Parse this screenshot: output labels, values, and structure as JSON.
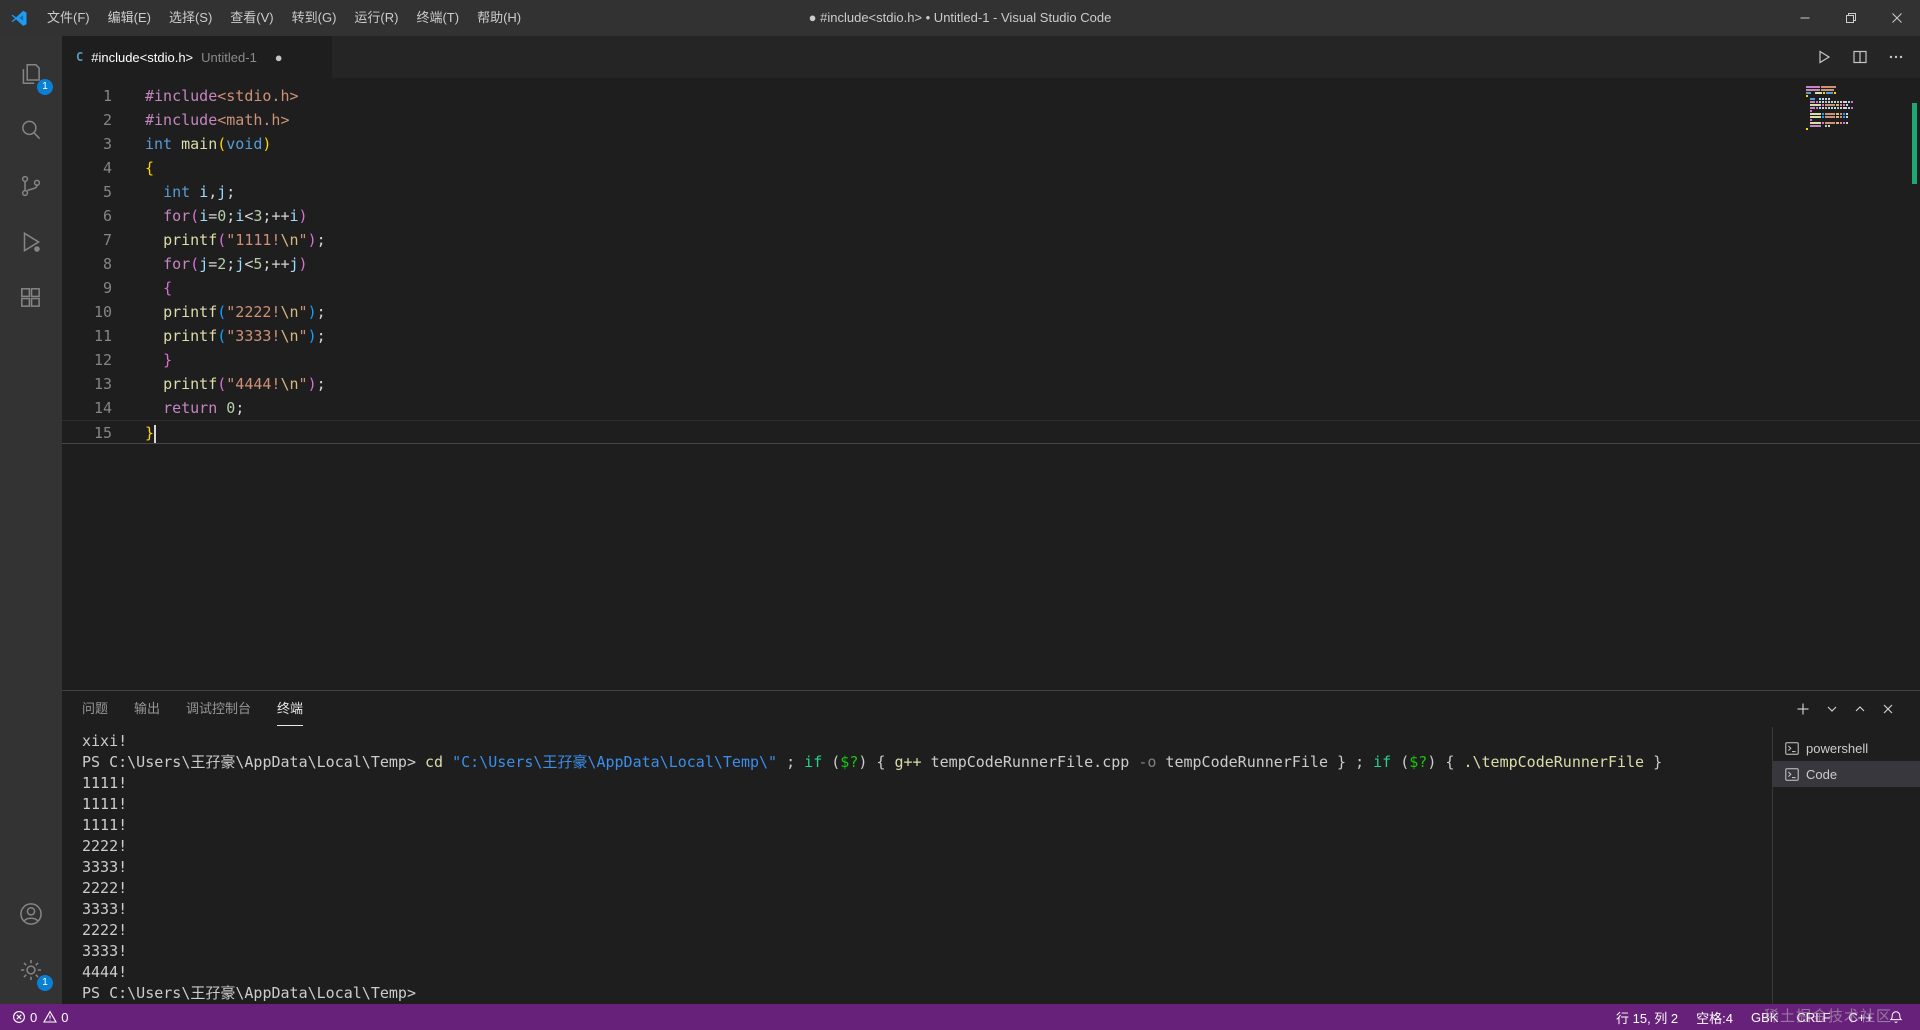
{
  "window": {
    "title": "● #include<stdio.h> • Untitled-1 - Visual Studio Code"
  },
  "menus": [
    "文件(F)",
    "编辑(E)",
    "选择(S)",
    "查看(V)",
    "转到(G)",
    "运行(R)",
    "终端(T)",
    "帮助(H)"
  ],
  "activity_bar": {
    "explorer_badge": "1",
    "settings_badge": "1"
  },
  "tab": {
    "file_icon": "C",
    "title": "#include<stdio.h>",
    "secondary": "Untitled-1",
    "dirty": "●"
  },
  "editor": {
    "cursor_line": 15,
    "lines": [
      [
        [
          "#include",
          "pp"
        ],
        [
          "<stdio.h>",
          "str"
        ]
      ],
      [
        [
          "#include",
          "pp"
        ],
        [
          "<math.h>",
          "str"
        ]
      ],
      [
        [
          "int",
          "kw"
        ],
        [
          " ",
          "pl"
        ],
        [
          "main",
          "fn"
        ],
        [
          "(",
          "b1"
        ],
        [
          "void",
          "kw"
        ],
        [
          ")",
          "b1"
        ]
      ],
      [
        [
          "{",
          "b1"
        ]
      ],
      [
        [
          "  ",
          "pl"
        ],
        [
          "int",
          "kw"
        ],
        [
          " ",
          "pl"
        ],
        [
          "i",
          "var"
        ],
        [
          ",",
          "pl"
        ],
        [
          "j",
          "var"
        ],
        [
          ";",
          "pl"
        ]
      ],
      [
        [
          "  ",
          "pl"
        ],
        [
          "for",
          "pp"
        ],
        [
          "(",
          "b2"
        ],
        [
          "i",
          "var"
        ],
        [
          "=",
          "pl"
        ],
        [
          "0",
          "num"
        ],
        [
          ";",
          "pl"
        ],
        [
          "i",
          "var"
        ],
        [
          "<",
          "pl"
        ],
        [
          "3",
          "num"
        ],
        [
          ";",
          "pl"
        ],
        [
          "++",
          "pl"
        ],
        [
          "i",
          "var"
        ],
        [
          ")",
          "b2"
        ]
      ],
      [
        [
          "  ",
          "pl"
        ],
        [
          "printf",
          "fn"
        ],
        [
          "(",
          "b2"
        ],
        [
          "\"1111!",
          "str"
        ],
        [
          "\\n",
          "esc"
        ],
        [
          "\"",
          "str"
        ],
        [
          ")",
          "b2"
        ],
        [
          ";",
          "pl"
        ]
      ],
      [
        [
          "  ",
          "pl"
        ],
        [
          "for",
          "pp"
        ],
        [
          "(",
          "b2"
        ],
        [
          "j",
          "var"
        ],
        [
          "=",
          "pl"
        ],
        [
          "2",
          "num"
        ],
        [
          ";",
          "pl"
        ],
        [
          "j",
          "var"
        ],
        [
          "<",
          "pl"
        ],
        [
          "5",
          "num"
        ],
        [
          ";",
          "pl"
        ],
        [
          "++",
          "pl"
        ],
        [
          "j",
          "var"
        ],
        [
          ")",
          "b2"
        ]
      ],
      [
        [
          "  ",
          "pl"
        ],
        [
          "{",
          "b2"
        ]
      ],
      [
        [
          "  ",
          "pl"
        ],
        [
          "printf",
          "fn"
        ],
        [
          "(",
          "b3"
        ],
        [
          "\"2222!",
          "str"
        ],
        [
          "\\n",
          "esc"
        ],
        [
          "\"",
          "str"
        ],
        [
          ")",
          "b3"
        ],
        [
          ";",
          "pl"
        ]
      ],
      [
        [
          "  ",
          "pl"
        ],
        [
          "printf",
          "fn"
        ],
        [
          "(",
          "b3"
        ],
        [
          "\"3333!",
          "str"
        ],
        [
          "\\n",
          "esc"
        ],
        [
          "\"",
          "str"
        ],
        [
          ")",
          "b3"
        ],
        [
          ";",
          "pl"
        ]
      ],
      [
        [
          "  ",
          "pl"
        ],
        [
          "}",
          "b2"
        ]
      ],
      [
        [
          "  ",
          "pl"
        ],
        [
          "printf",
          "fn"
        ],
        [
          "(",
          "b2"
        ],
        [
          "\"4444!",
          "str"
        ],
        [
          "\\n",
          "esc"
        ],
        [
          "\"",
          "str"
        ],
        [
          ")",
          "b2"
        ],
        [
          ";",
          "pl"
        ]
      ],
      [
        [
          "  ",
          "pl"
        ],
        [
          "return",
          "pp"
        ],
        [
          " ",
          "pl"
        ],
        [
          "0",
          "num"
        ],
        [
          ";",
          "pl"
        ]
      ],
      [
        [
          "}",
          "b1"
        ]
      ]
    ]
  },
  "panel": {
    "tabs": [
      {
        "label": "问题",
        "active": false
      },
      {
        "label": "输出",
        "active": false
      },
      {
        "label": "调试控制台",
        "active": false
      },
      {
        "label": "终端",
        "active": true
      }
    ],
    "terminal": {
      "lines": [
        [
          [
            "xixi!",
            "def"
          ]
        ],
        [
          [
            "PS C:\\Users\\王孖豪\\AppData\\Local\\Temp> ",
            "def"
          ],
          [
            "cd",
            "cmd"
          ],
          [
            " ",
            "def"
          ],
          [
            "\"C:\\Users\\王孖豪\\AppData\\Local\\Temp\\\"",
            "str"
          ],
          [
            " ; ",
            "def"
          ],
          [
            "if",
            "kw"
          ],
          [
            " (",
            "def"
          ],
          [
            "$?",
            "var"
          ],
          [
            ") { ",
            "def"
          ],
          [
            "g++",
            "cmd"
          ],
          [
            " tempCodeRunnerFile.cpp ",
            "def"
          ],
          [
            "-o",
            "param"
          ],
          [
            " tempCodeRunnerFile } ; ",
            "def"
          ],
          [
            "if",
            "kw"
          ],
          [
            " (",
            "def"
          ],
          [
            "$?",
            "var"
          ],
          [
            ") { ",
            "def"
          ],
          [
            ".\\tempCodeRunnerFile",
            "cmd"
          ],
          [
            " }",
            "def"
          ]
        ],
        [
          [
            "1111!",
            "def"
          ]
        ],
        [
          [
            "1111!",
            "def"
          ]
        ],
        [
          [
            "1111!",
            "def"
          ]
        ],
        [
          [
            "2222!",
            "def"
          ]
        ],
        [
          [
            "3333!",
            "def"
          ]
        ],
        [
          [
            "2222!",
            "def"
          ]
        ],
        [
          [
            "3333!",
            "def"
          ]
        ],
        [
          [
            "2222!",
            "def"
          ]
        ],
        [
          [
            "3333!",
            "def"
          ]
        ],
        [
          [
            "4444!",
            "def"
          ]
        ],
        [
          [
            "PS C:\\Users\\王孖豪\\AppData\\Local\\Temp>",
            "def"
          ]
        ]
      ],
      "sidebar": [
        {
          "label": "powershell",
          "selected": false
        },
        {
          "label": "Code",
          "selected": true
        }
      ]
    }
  },
  "statusbar": {
    "errors": "0",
    "warnings": "0",
    "items": [
      "行 15, 列 2",
      "空格:4",
      "GBK",
      "CRLF",
      "C++"
    ]
  },
  "watermark": "稀土掘金技术社区",
  "icons": {
    "vscode-logo": "vscode-mark",
    "explorer": "files",
    "search": "magnifier",
    "source-control": "branch",
    "run-debug": "play-with-bug",
    "extensions": "squares",
    "accounts": "person-circle",
    "settings": "gear",
    "run": "play-outline",
    "split-editor": "split-rect",
    "more-actions": "ellipsis",
    "new-terminal": "plus",
    "terminal-dropdown": "chevron-down",
    "maximize-panel": "chevron-up",
    "close-panel": "x",
    "terminal-tab": "terminal-box",
    "error": "circle-x",
    "warning": "triangle-exclamation",
    "notifications": "bell",
    "minimize": "dash",
    "restore": "overlapping-squares",
    "close": "x"
  }
}
